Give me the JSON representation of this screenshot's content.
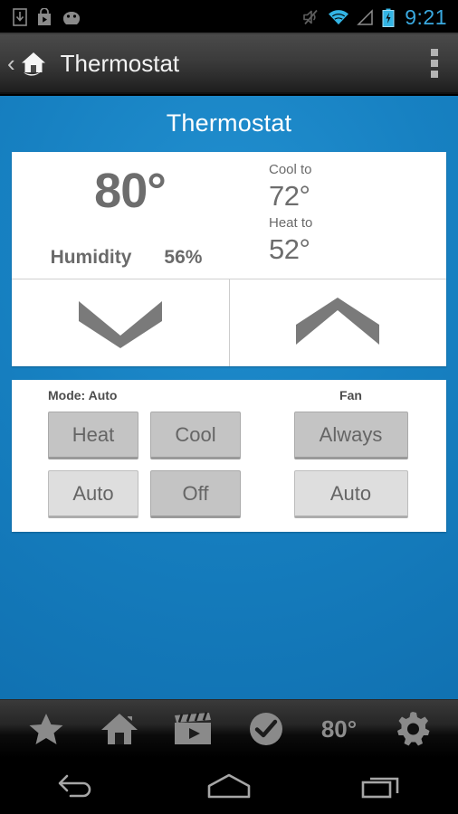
{
  "statusbar": {
    "left_icons": [
      {
        "name": "download-icon",
        "glyph": "download"
      },
      {
        "name": "play-store-icon",
        "glyph": "play-bag"
      },
      {
        "name": "android-head-icon",
        "glyph": "android"
      }
    ],
    "right_icons": [
      {
        "name": "mute-icon",
        "glyph": "speaker-mute"
      },
      {
        "name": "wifi-icon",
        "glyph": "wifi"
      },
      {
        "name": "cell-signal-icon",
        "glyph": "signal-triangle"
      },
      {
        "name": "battery-charging-icon",
        "glyph": "battery-bolt"
      }
    ],
    "time": "9:21",
    "time_color": "#3aa9e0",
    "accent_color": "#33b5e5"
  },
  "actionbar": {
    "back_glyph": "‹",
    "app_icon": "home-house-icon",
    "title": "Thermostat",
    "overflow_icon": "overflow-menu-icon"
  },
  "page": {
    "title": "Thermostat",
    "background_color": "#1781c2"
  },
  "thermostat": {
    "current_temp": "80°",
    "humidity_label": "Humidity",
    "humidity_value": "56%",
    "cool_to_label": "Cool to",
    "cool_to_value": "72°",
    "heat_to_label": "Heat to",
    "heat_to_value": "52°",
    "temp_down_icon": "chevron-down-icon",
    "temp_up_icon": "chevron-up-icon"
  },
  "controls": {
    "mode_label": "Mode: Auto",
    "mode_buttons": [
      {
        "label": "Heat",
        "selected": true
      },
      {
        "label": "Cool",
        "selected": true
      },
      {
        "label": "Auto",
        "selected": false
      },
      {
        "label": "Off",
        "selected": true
      }
    ],
    "fan_label": "Fan",
    "fan_buttons": [
      {
        "label": "Always",
        "selected": true
      },
      {
        "label": "Auto",
        "selected": false
      }
    ]
  },
  "toolbar": {
    "items": [
      {
        "name": "favorites-star-icon",
        "label": ""
      },
      {
        "name": "home-icon",
        "label": ""
      },
      {
        "name": "media-clapper-icon",
        "label": ""
      },
      {
        "name": "check-circle-icon",
        "label": ""
      },
      {
        "name": "temperature-readout",
        "label": "80°"
      },
      {
        "name": "settings-gear-icon",
        "label": ""
      }
    ]
  },
  "navbar": {
    "items": [
      {
        "name": "nav-back-icon"
      },
      {
        "name": "nav-home-icon"
      },
      {
        "name": "nav-recents-icon"
      }
    ]
  }
}
